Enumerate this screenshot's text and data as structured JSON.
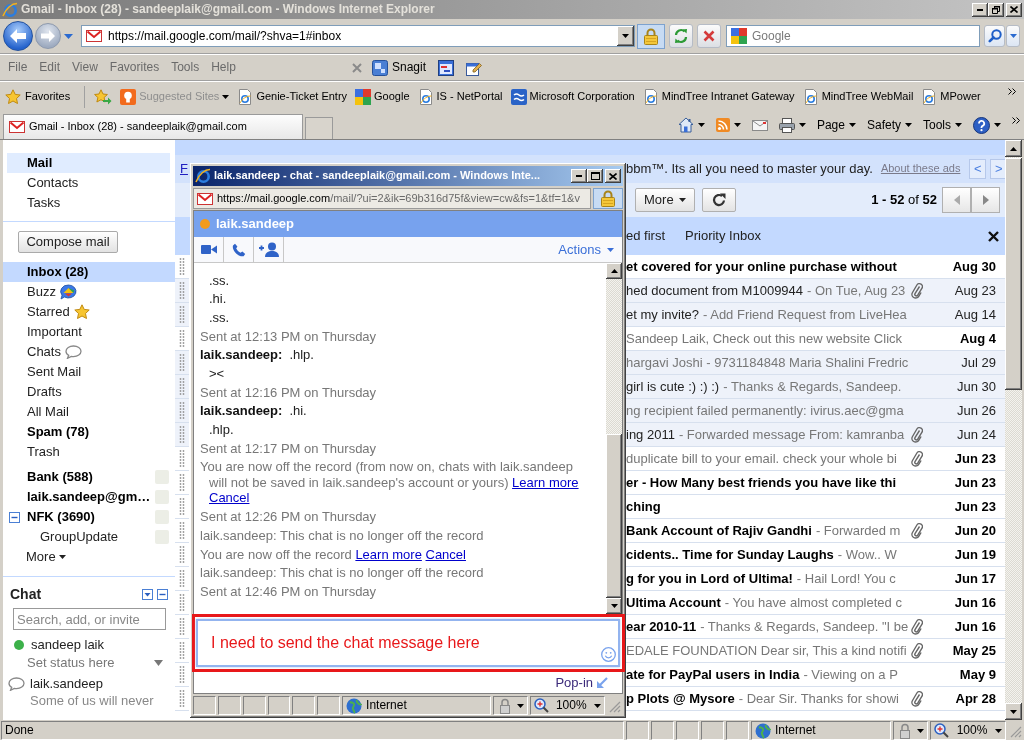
{
  "window": {
    "title": "Gmail - Inbox (28) - sandeeplaik@gmail.com - Windows Internet Explorer"
  },
  "address_bar": {
    "url": "https://mail.google.com/mail/?shva=1#inbox",
    "search_placeholder": "Google"
  },
  "menu_bar": {
    "items": [
      "File",
      "Edit",
      "View",
      "Favorites",
      "Tools",
      "Help"
    ],
    "addon_label": "Snagit"
  },
  "favorites_bar": {
    "label": "Favorites",
    "links": [
      {
        "kind": "suggested",
        "label": "Suggested Sites",
        "disabled": true
      },
      {
        "kind": "page",
        "label": "Genie-Ticket Entry",
        "disabled": false
      },
      {
        "kind": "squares",
        "label": "Google",
        "disabled": false
      },
      {
        "kind": "page",
        "label": "IS - NetPortal",
        "disabled": false
      },
      {
        "kind": "tile",
        "label": "Microsoft Corporation",
        "disabled": false
      },
      {
        "kind": "page",
        "label": "MindTree Intranet Gateway",
        "disabled": false
      },
      {
        "kind": "page",
        "label": "MindTree WebMail",
        "disabled": false
      },
      {
        "kind": "page",
        "label": "MPower",
        "disabled": false
      }
    ]
  },
  "tabs": [
    {
      "label": "Gmail - Inbox (28) - sandeeplaik@gmail.com",
      "selected": true
    }
  ],
  "command_bar": [
    {
      "kind": "home",
      "dropdown": true
    },
    {
      "kind": "feed",
      "dropdown": true
    },
    {
      "kind": "mail",
      "dropdown": false
    },
    {
      "kind": "print",
      "dropdown": true
    },
    {
      "kind": "menu",
      "label": "Page",
      "dropdown": true
    },
    {
      "kind": "menu",
      "label": "Safety",
      "dropdown": true
    },
    {
      "kind": "menu",
      "label": "Tools",
      "dropdown": true
    },
    {
      "kind": "help",
      "dropdown": true
    }
  ],
  "gmail": {
    "nav": [
      {
        "label": "Mail",
        "selected": true
      },
      {
        "label": "Contacts",
        "selected": false
      },
      {
        "label": "Tasks",
        "selected": false
      }
    ],
    "compose": "Compose mail",
    "folders": [
      {
        "label": "Inbox (28)",
        "kind": "plain",
        "selected": true,
        "unread": true
      },
      {
        "label": "Buzz",
        "kind": "buzz",
        "selected": false,
        "unread": false
      },
      {
        "label": "Starred",
        "kind": "star",
        "selected": false,
        "unread": false
      },
      {
        "label": "Important",
        "kind": "plain",
        "selected": false,
        "unread": false
      },
      {
        "label": "Chats",
        "kind": "chat",
        "selected": false,
        "unread": false
      },
      {
        "label": "Sent Mail",
        "kind": "plain",
        "selected": false,
        "unread": false
      },
      {
        "label": "Drafts",
        "kind": "plain",
        "selected": false,
        "unread": false
      },
      {
        "label": "All Mail",
        "kind": "plain",
        "selected": false,
        "unread": false
      },
      {
        "label": "Spam (78)",
        "kind": "plain",
        "selected": false,
        "unread": true
      },
      {
        "label": "Trash",
        "kind": "plain",
        "selected": false,
        "unread": false
      }
    ],
    "labels": [
      {
        "label": "Bank (588)",
        "unread": true
      },
      {
        "label": "laik.sandeep@gm…",
        "unread": true
      },
      {
        "label": "NFK (3690)",
        "unread": true,
        "expanded": true,
        "children": [
          {
            "label": "GroupUpdate",
            "unread": false
          }
        ]
      }
    ],
    "more": "More",
    "chat": {
      "title": "Chat",
      "search_placeholder": "Search, add, or invite",
      "me": {
        "name": "sandeep laik",
        "color": "#3cb14a",
        "status": "Set status here"
      },
      "contacts": [
        {
          "name": "laik.sandeep",
          "kind": "bubble",
          "status": "Some of us will never"
        }
      ]
    }
  },
  "mail_list": {
    "ad": {
      "link": "F",
      "text": "bbm™. Its all you need to master your day.",
      "about": "About these ads",
      "prev": "<",
      "next": ">"
    },
    "more_button": "More",
    "count": "**1 - 52** of **52**",
    "sort_links": [
      "ed first",
      "Priority Inbox"
    ],
    "rows": [
      {
        "subject": "et covered for your online purchase without",
        "date": "Aug 30",
        "unread": true,
        "attachment": false
      },
      {
        "subject": "hed document from M1009944",
        "snippet": "- On Tue, Aug 23",
        "date": "Aug 23",
        "unread": false,
        "attachment": true
      },
      {
        "subject": "et my invite?",
        "snippet": "- Add Friend Request from LiveHea",
        "date": "Aug 14",
        "unread": false,
        "attachment": false
      },
      {
        "snippet": "Sandeep Laik, Check out this new website Click",
        "date": "Aug 4",
        "unread": true,
        "attachment": false
      },
      {
        "snippet": "hargavi Joshi - 9731184848 Maria Shalini Fredric",
        "date": "Jul 29",
        "unread": false,
        "attachment": false
      },
      {
        "subject": "girl is cute :) :) :)",
        "snippet": "- Thanks & Regards, Sandeep.",
        "date": "Jun 30",
        "unread": false,
        "attachment": false
      },
      {
        "snippet": "ng recipient failed permanently: ivirus.aec@gma",
        "date": "Jun 26",
        "unread": false,
        "attachment": false
      },
      {
        "subject": "ing 2011",
        "snippet": "- Forwarded message From: kamranba",
        "date": "Jun 24",
        "unread": false,
        "attachment": true
      },
      {
        "snippet": "duplicate bill to your email. check your whole bi",
        "date": "Jun 23",
        "unread": true,
        "attachment": true
      },
      {
        "subject": "er - How Many best friends you have like thi",
        "date": "Jun 23",
        "unread": true,
        "attachment": false
      },
      {
        "subject": "ching",
        "date": "Jun 23",
        "unread": true,
        "attachment": false
      },
      {
        "subject": "Bank Account of Rajiv Gandhi",
        "snippet": "- Forwarded m",
        "date": "Jun 20",
        "unread": true,
        "attachment": true
      },
      {
        "subject": "cidents.. Time for Sunday Laughs",
        "snippet": "- Wow.. W",
        "date": "Jun 19",
        "unread": true,
        "attachment": false
      },
      {
        "subject": "g for you in Lord of Ultima!",
        "snippet": "- Hail Lord! You c",
        "date": "Jun 17",
        "unread": true,
        "attachment": false
      },
      {
        "subject": "Ultima Account",
        "snippet": "- You have almost completed c",
        "date": "Jun 16",
        "unread": true,
        "attachment": false
      },
      {
        "subject": "ear 2010-11",
        "snippet": "- Thanks & Regards, Sandeep. \"I be",
        "date": "Jun 16",
        "unread": true,
        "attachment": true
      },
      {
        "snippet": "EDALE FOUNDATION Dear sir, This a kind notifi",
        "date": "May 25",
        "unread": true,
        "attachment": true
      },
      {
        "subject": "ate for PayPal users in India",
        "snippet": "- Viewing on a P",
        "date": "May 9",
        "unread": true,
        "attachment": false
      },
      {
        "subject": "p Plots @ Mysore",
        "snippet": "- Dear Sir. Thanks for showi",
        "date": "Apr 28",
        "unread": true,
        "attachment": true
      }
    ]
  },
  "chat_window": {
    "title": "laik.sandeep - chat - sandeeplaik@gmail.com - Windows Inte...",
    "url_host": "https://mail.google.com",
    "url_path": "/mail/?ui=2&ik=69b316d75f&view=cw&fs=1&tf=1&v",
    "contact": {
      "name": "laik.sandeep",
      "color": "#f29b1d"
    },
    "actions": "Actions",
    "messages": [
      {
        "kind": "line",
        "text": ".ss."
      },
      {
        "kind": "line",
        "text": ".hi."
      },
      {
        "kind": "line",
        "text": ".ss."
      },
      {
        "kind": "time",
        "text": "Sent at 12:13 PM on Thursday"
      },
      {
        "kind": "message",
        "sender": "laik.sandeep:",
        "text": ".hlp."
      },
      {
        "kind": "line",
        "text": "><"
      },
      {
        "kind": "time",
        "text": "Sent at 12:16 PM on Thursday"
      },
      {
        "kind": "message",
        "sender": "laik.sandeep:",
        "text": ".hi."
      },
      {
        "kind": "line",
        "text": ".hlp."
      },
      {
        "kind": "time",
        "text": "Sent at 12:17 PM on Thursday"
      },
      {
        "kind": "notice",
        "text": "You are now off the record (from now on, chats with laik.sandeep will not be saved in laik.sandeep's account or yours)",
        "links": [
          "Learn more",
          "Cancel"
        ]
      },
      {
        "kind": "time",
        "text": "Sent at 12:26 PM on Thursday"
      },
      {
        "kind": "notice",
        "text": "laik.sandeep: This chat is no longer off the record"
      },
      {
        "kind": "notice",
        "text": "You are now off the record",
        "links": [
          "Learn more",
          "Cancel"
        ]
      },
      {
        "kind": "notice",
        "text": "laik.sandeep: This chat is no longer off the record"
      },
      {
        "kind": "time",
        "text": "Sent at 12:46 PM on Thursday"
      }
    ],
    "input_value": "I need to send the chat message here",
    "popin": "Pop-in",
    "status": {
      "zone": "Internet",
      "zoom": "100%"
    }
  },
  "status_bar": {
    "text": "Done",
    "zone": "Internet",
    "zoom": "100%"
  }
}
